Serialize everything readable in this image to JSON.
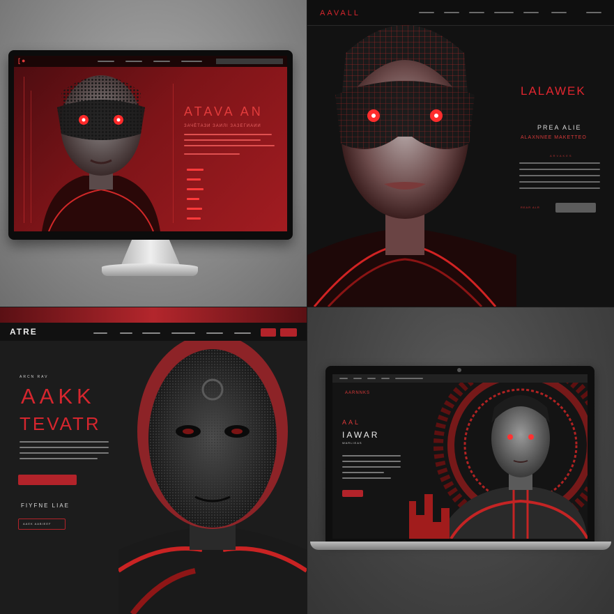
{
  "colors": {
    "accent": "#d0222a",
    "dark": "#141414",
    "panel_gray": "#5c5c5c"
  },
  "q1": {
    "nav_logo": "[●",
    "headline": "ATAVA AN",
    "subline": "ЗАЧЁТАЗИ ЗАИЛІ ЗАЗЕГИАИИ",
    "menu_items": [
      "—",
      "—",
      "—",
      "—",
      "—",
      "—"
    ]
  },
  "q2": {
    "logo": "AAVALL",
    "headline": "LALAWEK",
    "subhead": "PREA ALIE",
    "tagline": "ALAXNNEE MAKETTEO",
    "small_tag": "ARVAKES",
    "link": "REAR ALR",
    "button_label": ""
  },
  "q3": {
    "logo": "ATRE",
    "nav_items": [
      "—",
      "—",
      "—",
      "—",
      "—",
      "—"
    ],
    "kicker": "ARCN RAV",
    "headline_1": "AAKK",
    "headline_2": "TEVATR",
    "button_label": "",
    "section_title": "FIYFNE LIAE",
    "outline_button": "AAEK AABIEEF"
  },
  "q4": {
    "brand": "AARNNKS",
    "small_title": "AAL",
    "headline": "IAWAR",
    "tagline": "WARLIEAS",
    "button_label": ""
  }
}
